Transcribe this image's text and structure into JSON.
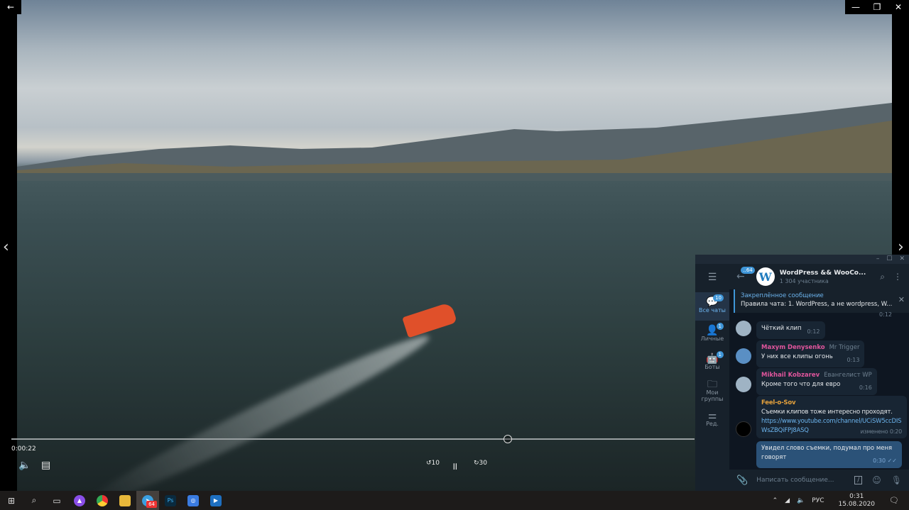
{
  "player": {
    "time": "0:00:22",
    "progress_percent": 57,
    "back_icon": "←",
    "rewind_label": "10",
    "forward_label": "30",
    "min": "—",
    "max": "❐",
    "close": "✕"
  },
  "telegram": {
    "window": {
      "min": "–",
      "max": "☐",
      "close": "✕"
    },
    "folders": [
      {
        "label": "Все чаты",
        "badge": "10"
      },
      {
        "label": "Личные",
        "badge": "1"
      },
      {
        "label": "Боты",
        "badge": "1"
      },
      {
        "label": "Мои группы",
        "badge": ""
      },
      {
        "label": "Ред.",
        "badge": ""
      }
    ],
    "back_badge": "..64",
    "chat": {
      "title": "WordPress && WooCo...",
      "subtitle": "1 304 участника"
    },
    "pinned": {
      "title": "Закреплённое сообщение",
      "text": "Правила чата:  1. WordPress, а не wordpress, W..."
    },
    "prev_time": "0:12",
    "messages": [
      {
        "author": "",
        "role": "",
        "text": "Чёткий клип",
        "time": "0:12"
      },
      {
        "author": "Maxym Denysenko",
        "role": "Mr Trigger",
        "text": "У них все клипы огонь",
        "time": "0:13"
      },
      {
        "author": "Mikhail Kobzarev",
        "role": "Евангелист WP",
        "text": "Кроме того что для евро",
        "time": "0:16"
      },
      {
        "author": "Feel-o-Sov",
        "role": "",
        "text": "Съемки клипов тоже интересно проходят.",
        "link": "https://www.youtube.com/channel/UCiSW5ccDISWsZBQiFPJ8ASQ",
        "time": "изменено 0:20"
      },
      {
        "author": "",
        "role": "",
        "text": "Увидел слово съемки, подумал про меня говорят",
        "time": "0:30"
      }
    ],
    "input_placeholder": "Написать сообщение..."
  },
  "taskbar": {
    "telegram_badge": "64",
    "lang": "РУС",
    "time": "0:31",
    "date": "15.08.2020"
  },
  "colors": {
    "accent": "#3f96d8",
    "name_pink": "#e0559c",
    "name_orange": "#e6a23c"
  }
}
